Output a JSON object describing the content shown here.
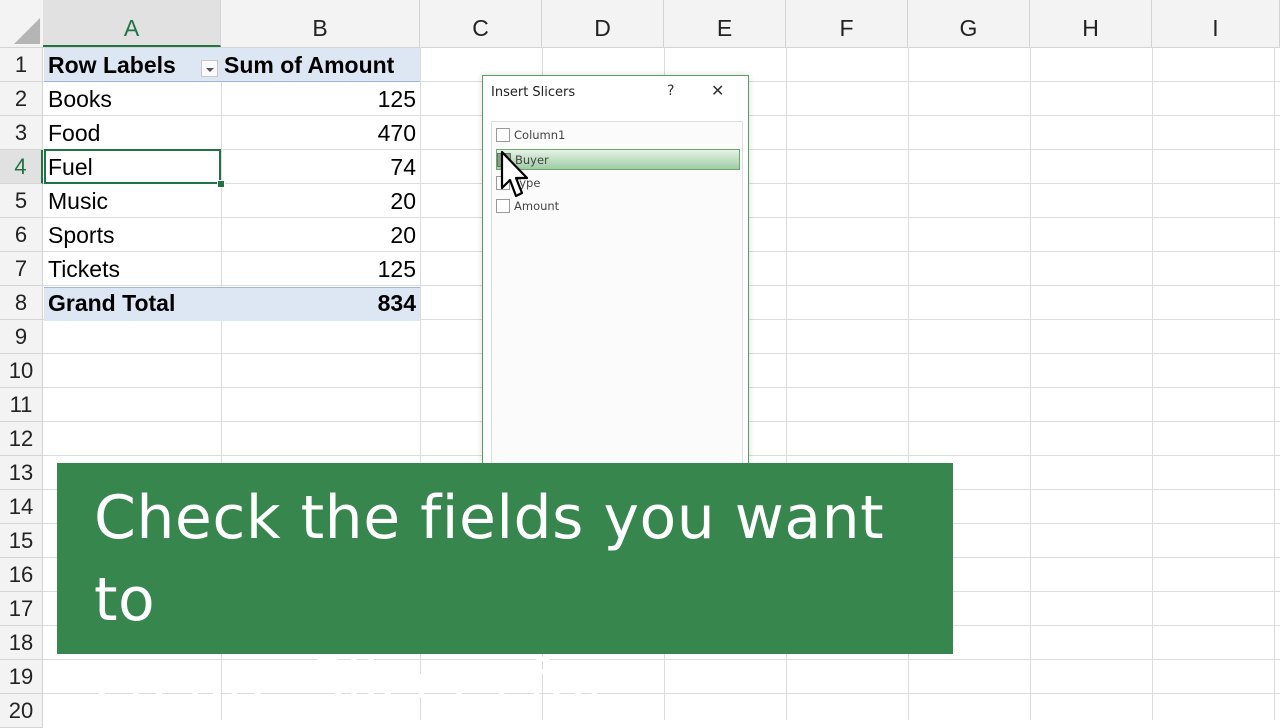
{
  "sheet": {
    "columns": [
      "A",
      "B",
      "C",
      "D",
      "E",
      "F",
      "G",
      "H",
      "I"
    ],
    "rows": [
      "1",
      "2",
      "3",
      "4",
      "5",
      "6",
      "7",
      "8",
      "9",
      "10",
      "11",
      "12",
      "13",
      "14",
      "15",
      "16",
      "17",
      "18",
      "19",
      "20"
    ],
    "pivot": {
      "header_label": "Row Labels",
      "header_value": "Sum of Amount",
      "rows": [
        {
          "label": "Books",
          "value": "125"
        },
        {
          "label": "Food",
          "value": "470"
        },
        {
          "label": "Fuel",
          "value": "74"
        },
        {
          "label": "Music",
          "value": "20"
        },
        {
          "label": "Sports",
          "value": "20"
        },
        {
          "label": "Tickets",
          "value": "125"
        }
      ],
      "total_label": "Grand Total",
      "total_value": "834"
    },
    "active_cell": "A4"
  },
  "dialog": {
    "title": "Insert Slicers",
    "help": "?",
    "close": "✕",
    "fields": [
      {
        "label": "Column1",
        "checked": false
      },
      {
        "label": "Buyer",
        "checked": false,
        "highlighted": true
      },
      {
        "label": "Type",
        "checked": false
      },
      {
        "label": "Amount",
        "checked": false
      }
    ]
  },
  "banner": {
    "line1": "Check the fields you want to",
    "line2": "create Slicers for"
  },
  "colors": {
    "excel_green": "#217346",
    "banner_green": "#36864e",
    "pivot_band": "#dde6f3"
  }
}
